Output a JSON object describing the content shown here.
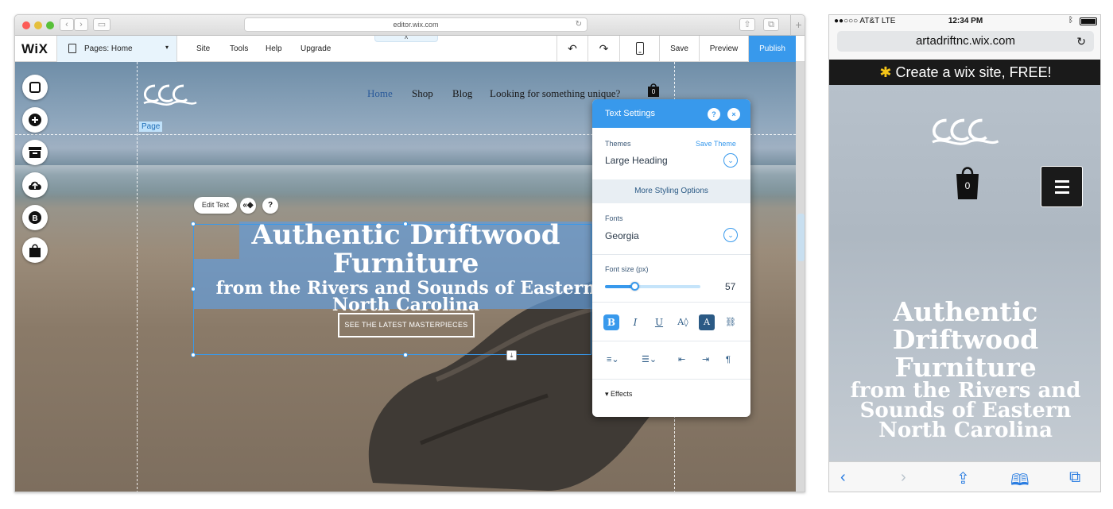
{
  "browser": {
    "url": "editor.wix.com",
    "tab_plus": "+",
    "back_arrow": "‹",
    "forward_arrow": "›",
    "reload": "↻"
  },
  "wix_bar": {
    "logo": "WiX",
    "pages_label": "Pages: Home",
    "pages_caret": "▾",
    "menu": [
      "Site",
      "Tools",
      "Help",
      "Upgrade"
    ],
    "collapse_caret": "˄",
    "undo": "↶",
    "redo": "↷",
    "save": "Save",
    "preview": "Preview",
    "publish": "Publish"
  },
  "canvas": {
    "page_tag": "Page",
    "nav": [
      "Home",
      "Shop",
      "Blog",
      "Looking for something unique?"
    ],
    "cart_count": "0",
    "edit_text": "Edit Text",
    "help_mark": "?",
    "heading": {
      "line1": "Authentic Driftwood",
      "line2": "Furniture",
      "line3": "from the Rivers and Sounds of Eastern",
      "line4": "North Carolina"
    },
    "cta": "SEE THE LATEST MASTERPIECES"
  },
  "rail_icons": [
    "add-icon",
    "background-icon",
    "add-apps-icon",
    "upload-icon",
    "blog-icon",
    "store-icon"
  ],
  "text_settings": {
    "title": "Text Settings",
    "help": "?",
    "close": "×",
    "themes_label": "Themes",
    "save_theme": "Save Theme",
    "theme_value": "Large Heading",
    "more_styling": "More Styling Options",
    "fonts_label": "Fonts",
    "font_value": "Georgia",
    "font_size_label": "Font size (px)",
    "font_size_value": "57",
    "font_size_fraction": 0.31,
    "format_buttons": [
      "B",
      "I",
      "U"
    ],
    "effects_label": "Effects",
    "accent_color": "#3899ec"
  },
  "phone": {
    "carrier": "●●○○○ AT&T  LTE",
    "time": "12:34 PM",
    "url": "artadriftnc.wix.com",
    "banner": "Create a wix site, FREE!",
    "cart_count": "0",
    "heading_lines": [
      "Authentic",
      "Driftwood",
      "Furniture"
    ],
    "sub_lines": [
      "from the Rivers and",
      "Sounds of Eastern",
      "North Carolina"
    ]
  }
}
